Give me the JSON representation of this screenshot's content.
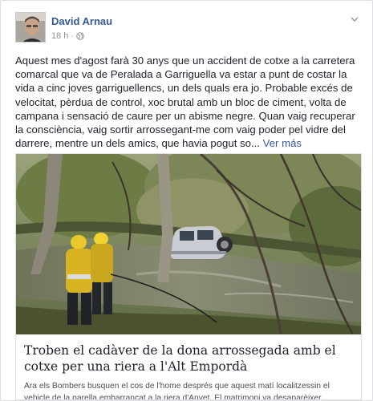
{
  "post": {
    "author": "David Arnau",
    "time": "18 h",
    "separator": "·",
    "text": "Aquest mes d'agost farà 30 anys que un accident de cotxe a la carretera comarcal que va de Peralada a Garriguella va estar a punt de costar la vida a cinc joves garriguellencs, un dels quals era jo. Probable excés de velocitat, pèrdua de control, xoc brutal amb un bloc de ciment, volta de campana i sensació de caure per un abisme negre. Quan vaig recuperar la consciència, vaig sortir arrossegant-me com vaig poder pel vidre del darrere, mentre un dels amics, que havia pogut so...",
    "see_more": "Ver más",
    "audience_icon": "globe-icon",
    "options_icon": "chevron-down-icon"
  },
  "link_preview": {
    "title": "Troben el cadàver de la dona arrossegada amb el cotxe per una riera a l'Alt Empordà",
    "description": "Ara els Bombers busquen el cos de l'home després que aquest matí localitzessin el vehicle de la parella embarrancat a la riera d'Anyet. El matrimoni va desaparèixer..."
  },
  "colors": {
    "author_link": "#365899",
    "meta_text": "#90949c",
    "body_text": "#1d2129",
    "card_border": "#dddfe2"
  }
}
